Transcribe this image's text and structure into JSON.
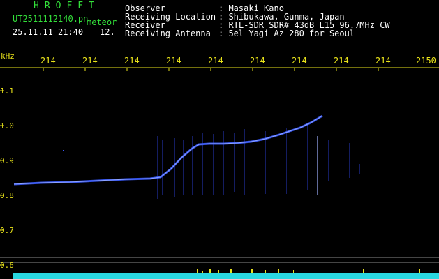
{
  "header": {
    "brand": "HROFFT",
    "filename": "UT2511112140.pn",
    "mode": "meteor",
    "datetime": "25.11.11 21:40",
    "count": "12.",
    "fields": [
      {
        "label": "Observer",
        "value": ": Masaki Kano"
      },
      {
        "label": "Receiving Location",
        "value": ": Shibukawa, Gunma, Japan"
      },
      {
        "label": "Receiver",
        "value": ": RTL-SDR SDR# 43dB L15 96.7MHz CW"
      },
      {
        "label": "Receiving Antenna",
        "value": ": 5el Yagi Az 280 for Seoul"
      }
    ]
  },
  "axes": {
    "y_unit": "kHz",
    "x_ticks": [
      "214",
      "214",
      "214",
      "214",
      "214",
      "214",
      "214",
      "214",
      "214",
      "2150"
    ],
    "y_ticks": [
      "1.1",
      "1.0",
      "0.9",
      "0.8",
      "0.7",
      "0.6"
    ]
  },
  "colors": {
    "header_green": "#33e03a",
    "tick_yellow": "#e8e21a",
    "trace_blue": "#3b5cff",
    "background": "#000000"
  }
}
